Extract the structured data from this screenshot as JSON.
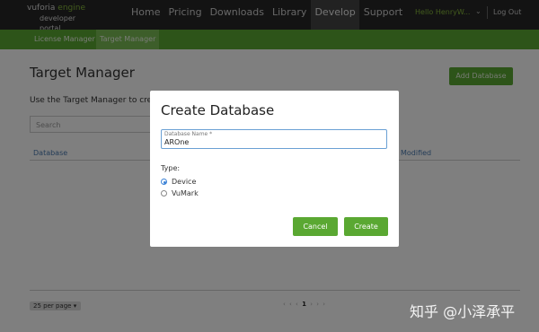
{
  "header": {
    "logo_line1": "vuforia",
    "logo_brand": " engine",
    "logo_line2": "developer portal",
    "nav": [
      "Home",
      "Pricing",
      "Downloads",
      "Library",
      "Develop",
      "Support"
    ],
    "active_nav": "Develop",
    "user": "Hello HenryW...",
    "logout": "Log Out"
  },
  "subnav": {
    "items": [
      "License Manager",
      "Target Manager"
    ],
    "active": "Target Manager"
  },
  "main": {
    "title": "Target Manager",
    "add_button": "Add Database",
    "description": "Use the Target Manager to create",
    "search_placeholder": "Search",
    "columns": {
      "database": "Database",
      "modified": "Modified"
    },
    "per_page": "25  per page",
    "pager": {
      "prev": "‹ ‹ ‹",
      "current": "1",
      "next": "› › ›"
    }
  },
  "modal": {
    "title": "Create Database",
    "field_label": "Database Name *",
    "field_value": "AROne",
    "type_label": "Type:",
    "options": [
      "Device",
      "VuMark"
    ],
    "selected": "Device",
    "cancel": "Cancel",
    "create": "Create"
  },
  "watermark": "知乎 @小泽承平",
  "colors": {
    "brand_green": "#5aa832",
    "nav_bg": "#262626",
    "link_blue": "#4a7ab0"
  }
}
